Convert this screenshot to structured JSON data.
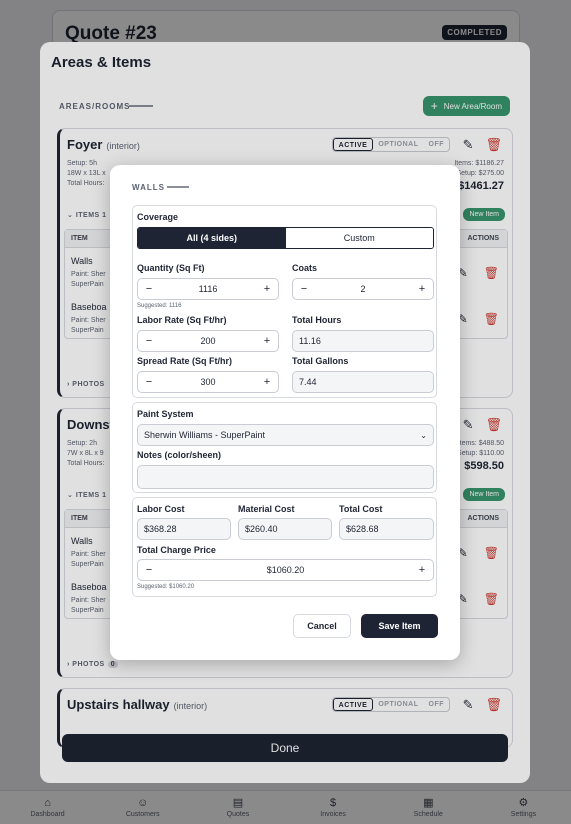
{
  "quote": {
    "title": "Quote #23",
    "status": "COMPLETED"
  },
  "sheet": {
    "title": "Areas & Items",
    "areas_label": "AREAS/ROOMS",
    "new_area_label": "New Area/Room",
    "done_label": "Done"
  },
  "segment": {
    "active": "ACTIVE",
    "optional": "OPTIONAL",
    "off": "OFF"
  },
  "areas": [
    {
      "name": "Foyer",
      "type": "(interior)",
      "setup": "Setup: 5h",
      "dims": "18W x 13L x",
      "total_hours": "Total Hours:",
      "items_total": "Items: $1186.27",
      "setup_total": "Setup: $275.00",
      "grand_total": "$1461.27",
      "items_label": "ITEMS 1",
      "new_item_label": "New Item",
      "col_item": "ITEM",
      "col_actions": "ACTIONS",
      "rows": [
        {
          "name": "Walls",
          "sub1": "Paint: Sher",
          "sub2": "SuperPain"
        },
        {
          "name": "Baseboa",
          "sub1": "Paint: Sher",
          "sub2": "SuperPain"
        }
      ],
      "photos_label": "PHOTOS"
    },
    {
      "name": "Downst",
      "type": "",
      "setup": "Setup: 2h",
      "dims": "7W x 8L x 9",
      "total_hours": "Total Hours:",
      "items_total": "Items: $488.50",
      "setup_total": "Setup: $110.00",
      "grand_total": "$598.50",
      "items_label": "ITEMS 1",
      "new_item_label": "New Item",
      "col_item": "ITEM",
      "col_actions": "ACTIONS",
      "rows": [
        {
          "name": "Walls",
          "sub1": "Paint: Sher",
          "sub2": "SuperPain"
        },
        {
          "name": "Baseboa",
          "sub1": "Paint: Sher",
          "sub2": "SuperPain"
        }
      ],
      "photos_label": "PHOTOS",
      "photos_count": "0"
    },
    {
      "name": "Upstairs hallway",
      "type": "(interior)"
    }
  ],
  "modal": {
    "label": "WALLS",
    "coverage_label": "Coverage",
    "coverage_options": [
      "All (4 sides)",
      "Custom"
    ],
    "quantity_label": "Quantity (Sq Ft)",
    "quantity_value": "1116",
    "quantity_hint": "Suggested: 1116",
    "coats_label": "Coats",
    "coats_value": "2",
    "labor_rate_label": "Labor Rate (Sq Ft/hr)",
    "labor_rate_value": "200",
    "total_hours_label": "Total Hours",
    "total_hours_value": "11.16",
    "spread_rate_label": "Spread Rate (Sq Ft/hr)",
    "spread_rate_value": "300",
    "total_gallons_label": "Total Gallons",
    "total_gallons_value": "7.44",
    "paint_system_label": "Paint System",
    "paint_system_value": "Sherwin Williams - SuperPaint",
    "notes_label": "Notes (color/sheen)",
    "notes_value": "",
    "labor_cost_label": "Labor Cost",
    "labor_cost_value": "$368.28",
    "material_cost_label": "Material Cost",
    "material_cost_value": "$260.40",
    "total_cost_label": "Total Cost",
    "total_cost_value": "$628.68",
    "charge_label": "Total Charge Price",
    "charge_value": "$1060.20",
    "charge_hint": "Suggested: $1060.20",
    "cancel_label": "Cancel",
    "save_label": "Save Item"
  },
  "nav": [
    {
      "label": "Dashboard",
      "icon": "home-icon"
    },
    {
      "label": "Customers",
      "icon": "users-icon"
    },
    {
      "label": "Quotes",
      "icon": "document-icon"
    },
    {
      "label": "Invoices",
      "icon": "dollar-icon"
    },
    {
      "label": "Schedule",
      "icon": "calendar-icon"
    },
    {
      "label": "Settings",
      "icon": "gear-icon"
    }
  ],
  "colors": {
    "primary": "#1e2433",
    "accent_green": "#37936b",
    "danger": "#cc3a33"
  }
}
